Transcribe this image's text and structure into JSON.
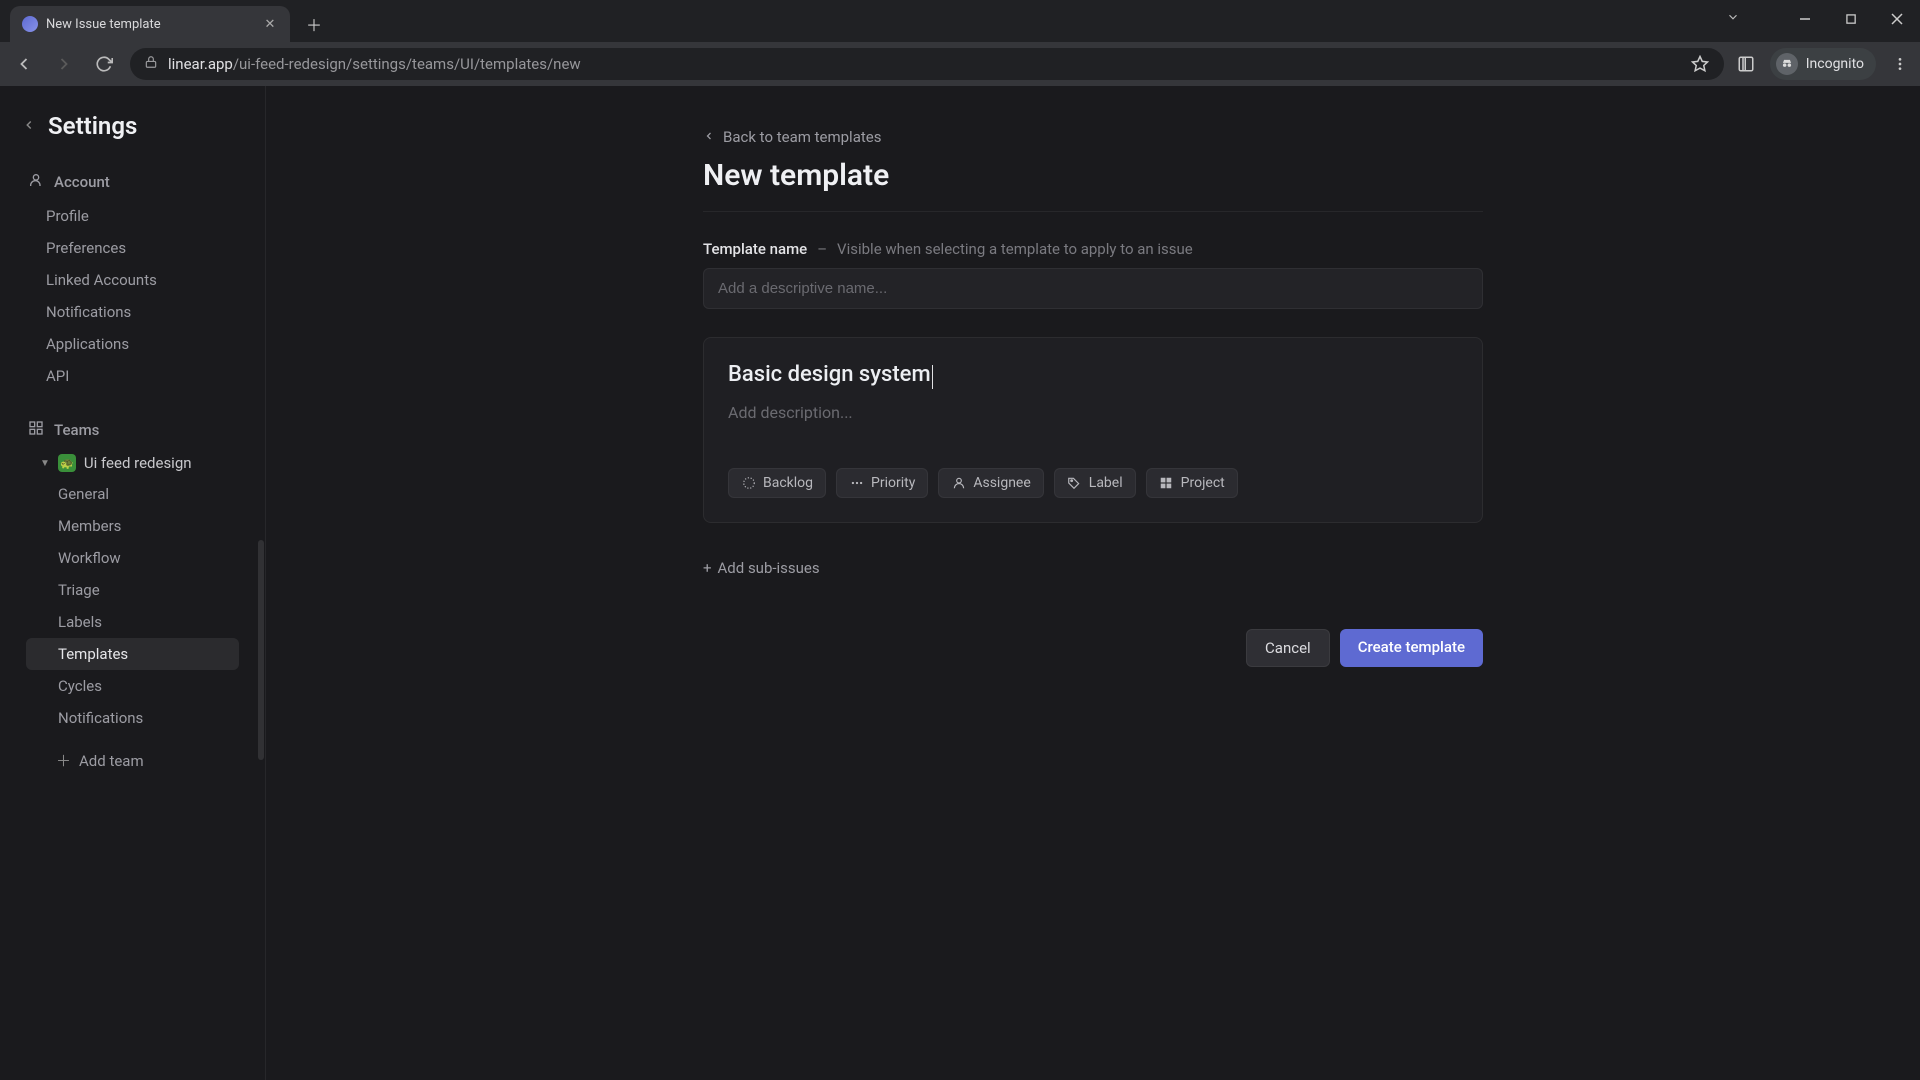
{
  "browser": {
    "tab_title": "New Issue template",
    "url_domain": "linear.app",
    "url_path": "/ui-feed-redesign/settings/teams/UI/templates/new",
    "incognito_label": "Incognito"
  },
  "sidebar": {
    "title": "Settings",
    "account_label": "Account",
    "account_items": [
      "Profile",
      "Preferences",
      "Linked Accounts",
      "Notifications",
      "Applications",
      "API"
    ],
    "teams_label": "Teams",
    "team_name": "Ui feed redesign",
    "team_emoji": "🐢",
    "team_items": [
      "General",
      "Members",
      "Workflow",
      "Triage",
      "Labels",
      "Templates",
      "Cycles",
      "Notifications"
    ],
    "active_team_item": "Templates",
    "add_team_label": "Add team"
  },
  "main": {
    "back_link": "Back to team templates",
    "page_title": "New template",
    "template_name_label": "Template name",
    "template_name_hint": "Visible when selecting a template to apply to an issue",
    "template_name_placeholder": "Add a descriptive name...",
    "template_name_value": "",
    "issue_title_value": "Basic design system",
    "description_placeholder": "Add description...",
    "properties": {
      "status": "Backlog",
      "priority": "Priority",
      "assignee": "Assignee",
      "label": "Label",
      "project": "Project"
    },
    "add_sub_issues": "Add sub-issues",
    "cancel": "Cancel",
    "create": "Create template"
  }
}
